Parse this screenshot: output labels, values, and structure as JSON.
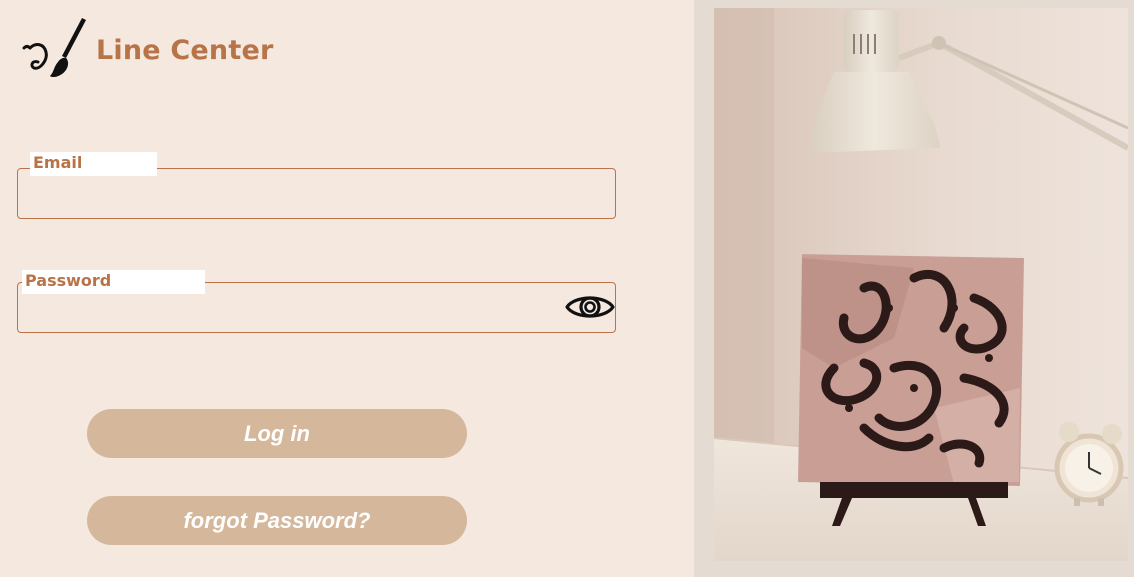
{
  "brand": {
    "name": "Line Center",
    "logo_icon": "paintbrush-icon"
  },
  "form": {
    "email": {
      "label": "Email",
      "value": "",
      "placeholder": ""
    },
    "password": {
      "label": "Password",
      "value": "",
      "placeholder": "",
      "toggle_icon": "eye-icon"
    },
    "login_label": "Log in",
    "forgot_label": "forgot Password?"
  },
  "colors": {
    "background": "#f4e8df",
    "accent": "#b87448",
    "button": "#d5b89c",
    "panel": "#e4dcd2"
  }
}
